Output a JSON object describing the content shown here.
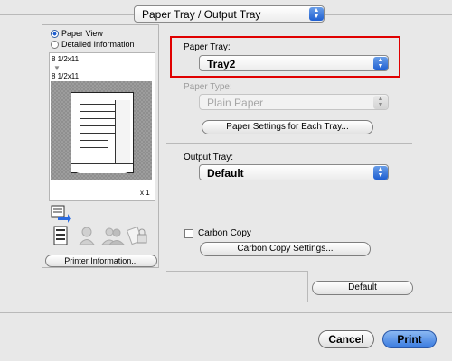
{
  "header": {
    "panel_popup_label": "Paper Tray / Output Tray"
  },
  "left_panel": {
    "view_options": [
      {
        "label": "Paper View",
        "selected": true
      },
      {
        "label": "Detailed Information",
        "selected": false
      }
    ],
    "paper_size_from": "8 1/2x11",
    "paper_size_to": "8 1/2x11",
    "copies_label": "x 1",
    "printer_info_button": "Printer Information..."
  },
  "right_panel": {
    "paper_tray": {
      "label": "Paper Tray:",
      "value": "Tray2"
    },
    "paper_type": {
      "label": "Paper Type:",
      "value": "Plain Paper",
      "disabled": true
    },
    "paper_settings_button": "Paper Settings for Each Tray...",
    "output_tray": {
      "label": "Output Tray:",
      "value": "Default"
    },
    "carbon_copy": {
      "label": "Carbon Copy",
      "checked": false
    },
    "carbon_copy_settings_button": "Carbon Copy Settings...",
    "default_button": "Default"
  },
  "footer": {
    "cancel_button": "Cancel",
    "print_button": "Print"
  },
  "colors": {
    "highlight": "#e00000",
    "accent": "#1f5fd1"
  }
}
